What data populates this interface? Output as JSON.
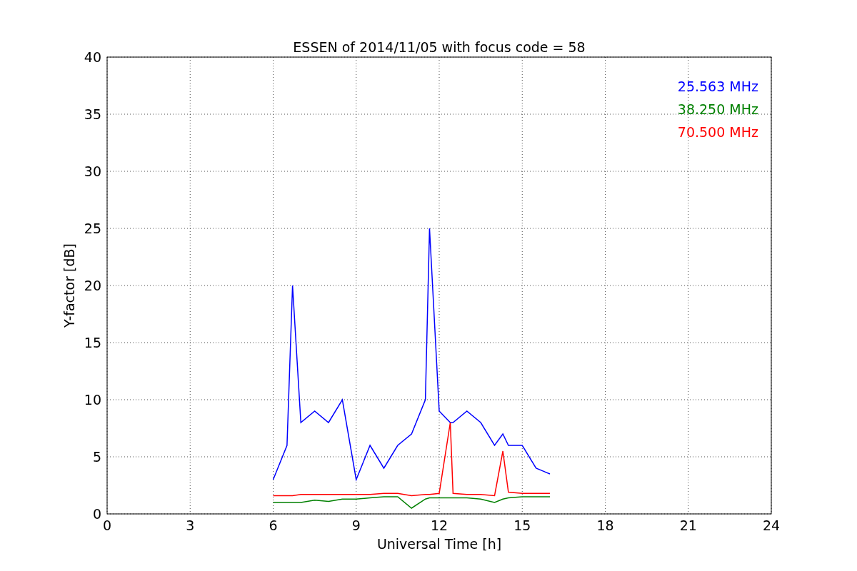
{
  "chart_data": {
    "type": "line",
    "title": "ESSEN of 2014/11/05 with focus code = 58",
    "xlabel": "Universal Time [h]",
    "ylabel": "Y-factor [dB]",
    "x": [
      6,
      6.5,
      6.7,
      7,
      7.5,
      8,
      8.5,
      9,
      9.5,
      10,
      10.5,
      11,
      11.5,
      11.65,
      12,
      12.4,
      12.5,
      13,
      13.5,
      14,
      14.3,
      14.5,
      15,
      15.5,
      16
    ],
    "series": [
      {
        "name": "25.563 MHz",
        "color": "#0000ff",
        "values": [
          3,
          6,
          20,
          8,
          9,
          8,
          10,
          3,
          6,
          4,
          6,
          7,
          10,
          25,
          9,
          8,
          8,
          9,
          8,
          6,
          7,
          6,
          6,
          4,
          3.5
        ]
      },
      {
        "name": "38.250 MHz",
        "color": "#008000",
        "values": [
          1,
          1,
          1,
          1,
          1.2,
          1.1,
          1.3,
          1.3,
          1.4,
          1.5,
          1.5,
          0.5,
          1.3,
          1.4,
          1.4,
          1.4,
          1.4,
          1.4,
          1.3,
          1,
          1.3,
          1.4,
          1.5,
          1.5,
          1.5
        ]
      },
      {
        "name": "70.500 MHz",
        "color": "#ff0000",
        "values": [
          1.6,
          1.6,
          1.6,
          1.7,
          1.7,
          1.7,
          1.7,
          1.7,
          1.7,
          1.8,
          1.8,
          1.6,
          1.7,
          1.7,
          1.8,
          8,
          1.8,
          1.7,
          1.7,
          1.6,
          5.5,
          1.9,
          1.8,
          1.8,
          1.8
        ]
      }
    ],
    "xlim": [
      0,
      24
    ],
    "ylim": [
      0,
      40
    ],
    "xticks": [
      0,
      3,
      6,
      9,
      12,
      15,
      18,
      21,
      24
    ],
    "yticks": [
      0,
      5,
      10,
      15,
      20,
      25,
      30,
      35,
      40
    ],
    "grid": true
  }
}
